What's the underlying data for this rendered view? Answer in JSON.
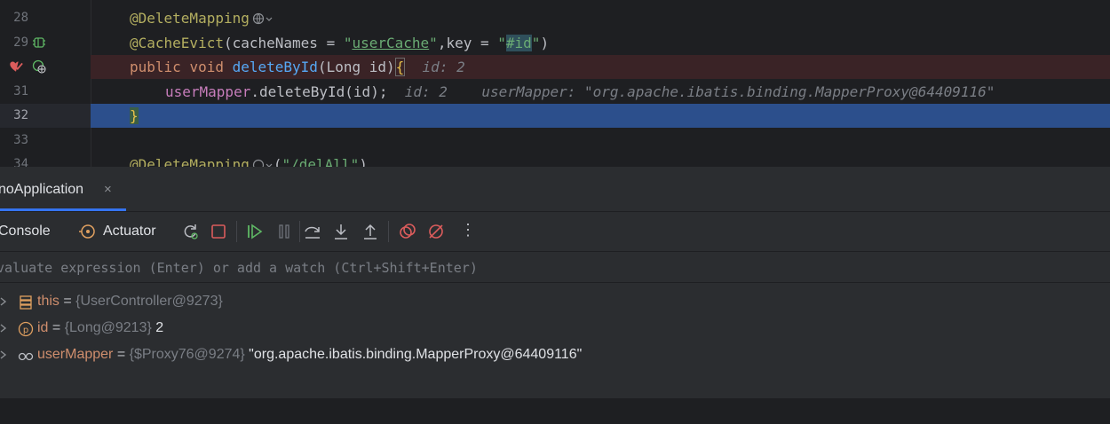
{
  "editor": {
    "lines": [
      {
        "num": "28",
        "parts": [
          {
            "t": "@DeleteMapping",
            "c": "ann"
          }
        ]
      },
      {
        "num": "29",
        "parts": [
          {
            "t": "@CacheEvict",
            "c": "ann"
          },
          {
            "t": "(cacheNames = ",
            "c": ""
          },
          {
            "t": "\"",
            "c": "str"
          },
          {
            "t": "userCache",
            "c": "str-u"
          },
          {
            "t": "\"",
            "c": "str"
          },
          {
            "t": ",key = ",
            "c": ""
          },
          {
            "t": "\"",
            "c": "str"
          },
          {
            "t": "#id",
            "c": "str-hl"
          },
          {
            "t": "\"",
            "c": "str"
          },
          {
            "t": ")",
            "c": ""
          }
        ]
      },
      {
        "num": "",
        "parts": [
          {
            "t": "public ",
            "c": "kw"
          },
          {
            "t": "void ",
            "c": "kw"
          },
          {
            "t": "deleteById",
            "c": "fn"
          },
          {
            "t": "(Long id)",
            "c": ""
          },
          {
            "t": "{",
            "c": "brace"
          },
          {
            "t": "  id: 2",
            "c": "inlay"
          }
        ]
      },
      {
        "num": "31",
        "parts": [
          {
            "t": "userMapper",
            "c": "kw"
          },
          {
            "t": ".deleteById(id);",
            "c": ""
          },
          {
            "t": "  id: 2    userMapper: \"org.apache.ibatis.binding.MapperProxy@64409116\"",
            "c": "inlay"
          }
        ]
      },
      {
        "num": "32",
        "parts": [
          {
            "t": "}",
            "c": "brace"
          }
        ]
      },
      {
        "num": "33",
        "parts": []
      },
      {
        "num": "34",
        "parts": [
          {
            "t": "@DeleteMapping",
            "c": "ann"
          },
          {
            "t": "(",
            "c": ""
          },
          {
            "t": "\"/delAll\"",
            "c": "str"
          },
          {
            "t": ")",
            "c": ""
          }
        ]
      }
    ]
  },
  "debug": {
    "tab_label": "noApplication",
    "tab_close": "×",
    "toolbar": {
      "console_label": "Console",
      "actuator_label": "Actuator",
      "more_label": "⋮"
    },
    "eval_placeholder": "valuate expression (Enter) or add a watch (Ctrl+Shift+Enter)",
    "variables": [
      {
        "name": "this",
        "eq": " = ",
        "type": "{UserController@9273}",
        "value": ""
      },
      {
        "name": "id",
        "eq": " = ",
        "type": "{Long@9213}",
        "value": " 2"
      },
      {
        "name": "userMapper",
        "eq": " = ",
        "type": "{$Proxy76@9274}",
        "value": " \"org.apache.ibatis.binding.MapperProxy@64409116\""
      }
    ]
  },
  "colors": {
    "accent": "#3574f0",
    "breakpoint_line": "#3a2326",
    "execution_line": "#2c4f8c",
    "stop_red": "#db5c5c",
    "resume_green": "#5fb865"
  }
}
